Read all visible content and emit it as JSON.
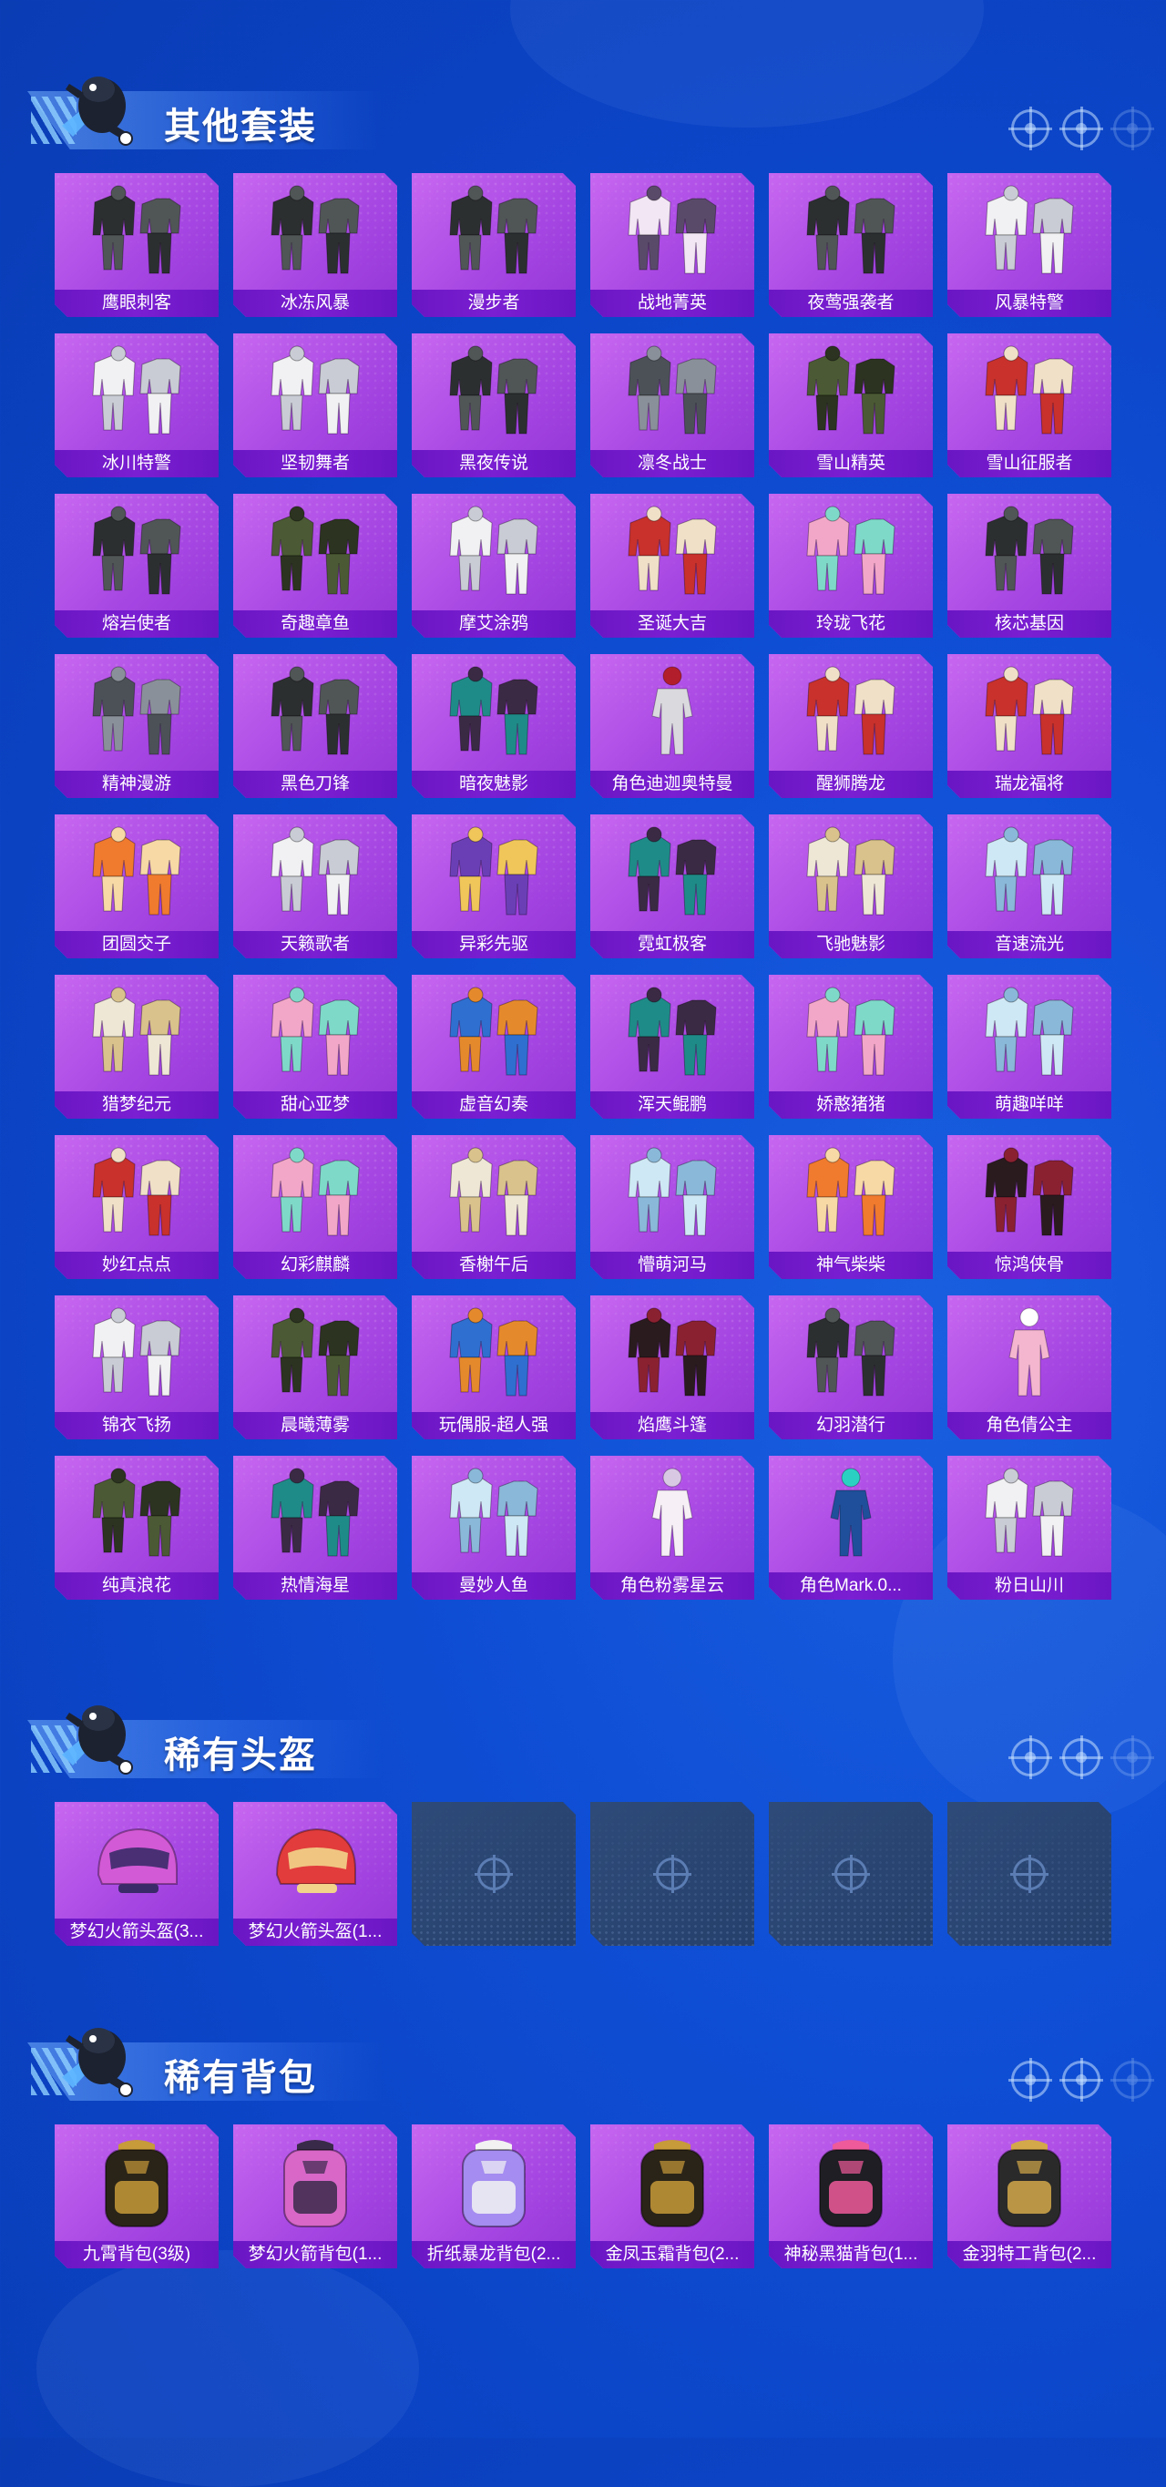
{
  "colors": {
    "background": "#0f4fd6",
    "card_purple": "#b556e8",
    "label_bar": "#7018c8",
    "empty_slot": "#2b4572"
  },
  "sections": [
    {
      "title": "其他套装",
      "items": [
        {
          "label": "鹰眼刺客",
          "art": "dark-suit"
        },
        {
          "label": "冰冻风暴",
          "art": "dark-suit"
        },
        {
          "label": "漫步者",
          "art": "dark-suit"
        },
        {
          "label": "战地菁英",
          "art": "striped-suit"
        },
        {
          "label": "夜莺强袭者",
          "art": "dark-suit"
        },
        {
          "label": "风暴特警",
          "art": "white-suit"
        },
        {
          "label": "冰川特警",
          "art": "white-suit"
        },
        {
          "label": "坚韧舞者",
          "art": "white-suit"
        },
        {
          "label": "黑夜传说",
          "art": "dark-suit"
        },
        {
          "label": "凛冬战士",
          "art": "gray-suit"
        },
        {
          "label": "雪山精英",
          "art": "green-suit"
        },
        {
          "label": "雪山征服者",
          "art": "red-suit"
        },
        {
          "label": "熔岩使者",
          "art": "dark-suit"
        },
        {
          "label": "奇趣章鱼",
          "art": "green-suit"
        },
        {
          "label": "摩艾涂鸦",
          "art": "white-suit"
        },
        {
          "label": "圣诞大吉",
          "art": "red-suit"
        },
        {
          "label": "玲珑飞花",
          "art": "pink-suit"
        },
        {
          "label": "核芯基因",
          "art": "dark-suit"
        },
        {
          "label": "精神漫游",
          "art": "gray-suit"
        },
        {
          "label": "黑色刀锋",
          "art": "dark-suit"
        },
        {
          "label": "暗夜魅影",
          "art": "teal-suit"
        },
        {
          "label": "角色迪迦奥特曼",
          "art": "silver-figure"
        },
        {
          "label": "醒狮腾龙",
          "art": "red-suit"
        },
        {
          "label": "瑞龙福将",
          "art": "red-suit"
        },
        {
          "label": "团圆交子",
          "art": "orange-suit"
        },
        {
          "label": "天籁歌者",
          "art": "white-suit"
        },
        {
          "label": "异彩先驱",
          "art": "purple-suit"
        },
        {
          "label": "霓虹极客",
          "art": "teal-suit"
        },
        {
          "label": "飞驰魅影",
          "art": "cream-suit"
        },
        {
          "label": "音速流光",
          "art": "light-blue-suit"
        },
        {
          "label": "猎梦纪元",
          "art": "cream-suit"
        },
        {
          "label": "甜心亚梦",
          "art": "pink-suit"
        },
        {
          "label": "虚音幻奏",
          "art": "blue-suit"
        },
        {
          "label": "浑天鲲鹏",
          "art": "teal-suit"
        },
        {
          "label": "娇憨猪猪",
          "art": "pink-suit"
        },
        {
          "label": "萌趣咩咩",
          "art": "light-blue-suit"
        },
        {
          "label": "妙红点点",
          "art": "red-suit"
        },
        {
          "label": "幻彩麒麟",
          "art": "pink-suit"
        },
        {
          "label": "香榭午后",
          "art": "cream-suit"
        },
        {
          "label": "懵萌河马",
          "art": "light-blue-suit"
        },
        {
          "label": "神气柴柴",
          "art": "orange-suit"
        },
        {
          "label": "惊鸿侠骨",
          "art": "dark-red-suit"
        },
        {
          "label": "锦衣飞扬",
          "art": "white-suit"
        },
        {
          "label": "晨曦薄雾",
          "art": "green-suit"
        },
        {
          "label": "玩偶服-超人强",
          "art": "blue-suit"
        },
        {
          "label": "焰鹰斗篷",
          "art": "dark-red-suit"
        },
        {
          "label": "幻羽潜行",
          "art": "dark-suit"
        },
        {
          "label": "角色倩公主",
          "art": "pink-figure"
        },
        {
          "label": "纯真浪花",
          "art": "green-suit"
        },
        {
          "label": "热情海星",
          "art": "teal-suit"
        },
        {
          "label": "曼妙人鱼",
          "art": "light-blue-suit"
        },
        {
          "label": "角色粉雾星云",
          "art": "white-figure"
        },
        {
          "label": "角色Mark.0...",
          "art": "blue-figure"
        },
        {
          "label": "粉日山川",
          "art": "white-suit"
        }
      ]
    },
    {
      "title": "稀有头盔",
      "items": [
        {
          "label": "梦幻火箭头盔(3...",
          "art": "helmet-pink"
        },
        {
          "label": "梦幻火箭头盔(1...",
          "art": "helmet-red"
        },
        {
          "label": "",
          "art": "empty"
        },
        {
          "label": "",
          "art": "empty"
        },
        {
          "label": "",
          "art": "empty"
        },
        {
          "label": "",
          "art": "empty"
        }
      ]
    },
    {
      "title": "稀有背包",
      "items": [
        {
          "label": "九霄背包(3级)",
          "art": "backpack-gold"
        },
        {
          "label": "梦幻火箭背包(1...",
          "art": "backpack-pink"
        },
        {
          "label": "折纸暴龙背包(2...",
          "art": "backpack-purple"
        },
        {
          "label": "金凤玉霜背包(2...",
          "art": "backpack-gold"
        },
        {
          "label": "神秘黑猫背包(1...",
          "art": "backpack-cat"
        },
        {
          "label": "金羽特工背包(2...",
          "art": "backpack-dark"
        }
      ]
    }
  ]
}
